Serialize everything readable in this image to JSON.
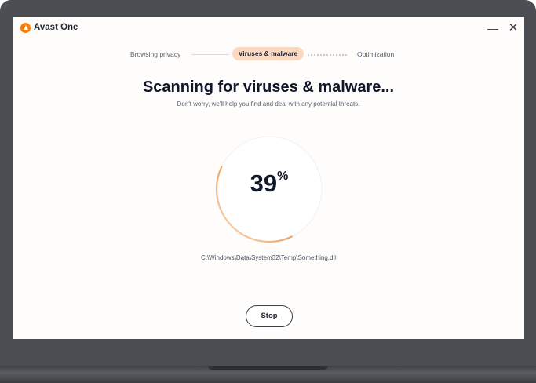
{
  "app": {
    "title": "Avast One"
  },
  "window_controls": {
    "minimize": "—",
    "close": "✕"
  },
  "stepper": {
    "steps": [
      {
        "label": "Browsing privacy",
        "state": "done"
      },
      {
        "label": "Viruses & malware",
        "state": "active"
      },
      {
        "label": "Optimization",
        "state": "pending"
      }
    ]
  },
  "scan": {
    "heading": "Scanning for viruses & malware...",
    "subheading": "Don't worry, we'll help you find and deal with any potential threats.",
    "progress": 39,
    "progress_number": "39",
    "progress_unit": "%",
    "current_file": "C:\\Windows\\Data\\System32\\Temp\\Something.dll"
  },
  "actions": {
    "stop_label": "Stop"
  },
  "colors": {
    "accent": "#ff7a00",
    "active_step_bg": "#fbd9c0",
    "heading": "#10172a",
    "frame": "#4a4e52"
  },
  "icons": {
    "logo": "avast-logo-icon",
    "minimize": "minimize-icon",
    "close": "close-icon"
  }
}
